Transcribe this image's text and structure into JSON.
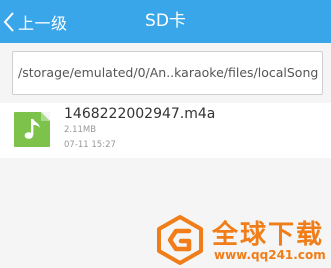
{
  "header": {
    "back_label": "上一级",
    "title": "SD卡",
    "background_color": "#3aa6ea"
  },
  "path": {
    "value": "/storage/emulated/0/An..karaoke/files/localSong"
  },
  "files": [
    {
      "name": "1468222002947.m4a",
      "size": "2.11MB",
      "date": "07-11 15:27",
      "icon": "music-file-icon",
      "icon_color": "#7cc24b"
    }
  ],
  "watermark": {
    "title": "全球下载",
    "url": "www.qq241.com",
    "color": "#f07d18"
  }
}
